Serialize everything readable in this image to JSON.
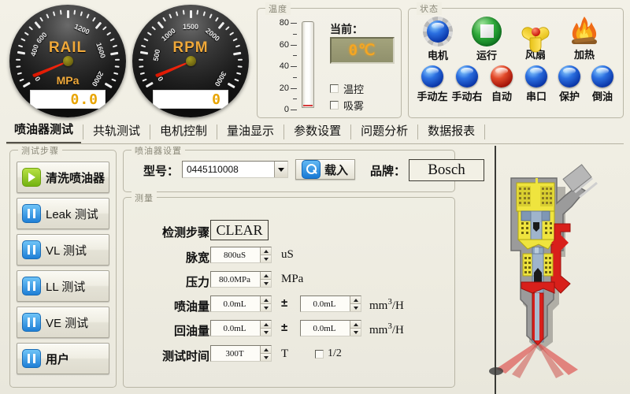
{
  "gauges": [
    {
      "name": "RAIL",
      "unit": "MPa",
      "value": "0.0",
      "ticks": [
        "0",
        "400",
        "600",
        "1200",
        "1600",
        "2000"
      ],
      "tick_values": [
        0,
        400,
        600,
        1200,
        1600,
        2000
      ],
      "min": 0,
      "max": 2000
    },
    {
      "name": "RPM",
      "unit": "",
      "value": "0",
      "ticks": [
        "0",
        "500",
        "1000",
        "1500",
        "2000",
        "3000"
      ],
      "tick_values": [
        0,
        500,
        1000,
        1500,
        2000,
        3000
      ],
      "min": 0,
      "max": 3000
    }
  ],
  "temperature": {
    "caption": "温度",
    "scale": [
      "80",
      "60",
      "40",
      "20",
      "0"
    ],
    "scale_max": 80,
    "current_label": "当前：",
    "current_value": "0℃",
    "checkboxes": [
      {
        "label": "温控",
        "checked": false
      },
      {
        "label": "吸雾",
        "checked": false
      }
    ]
  },
  "status": {
    "caption": "状态",
    "icons": [
      {
        "label": "电机",
        "icon": "gear-motor-icon"
      },
      {
        "label": "运行",
        "icon": "run-stop-icon"
      },
      {
        "label": "风扇",
        "icon": "fan-icon"
      },
      {
        "label": "加热",
        "icon": "fire-heat-icon"
      }
    ],
    "leds": [
      {
        "label": "手动左",
        "color": "#1d3fb0",
        "on": false
      },
      {
        "label": "手动右",
        "color": "#1d3fb0",
        "on": false
      },
      {
        "label": "自动",
        "color": "#c8200d",
        "on": true
      },
      {
        "label": "串口",
        "color": "#1d3fb0",
        "on": false
      },
      {
        "label": "保护",
        "color": "#1d3fb0",
        "on": false
      },
      {
        "label": "倒油",
        "color": "#1d3fb0",
        "on": false
      }
    ]
  },
  "tabs": [
    {
      "label": "喷油器测试",
      "active": true
    },
    {
      "label": "共轨测试",
      "active": false
    },
    {
      "label": "电机控制",
      "active": false
    },
    {
      "label": "量油显示",
      "active": false
    },
    {
      "label": "参数设置",
      "active": false
    },
    {
      "label": "问题分析",
      "active": false
    },
    {
      "label": "数据报表",
      "active": false
    }
  ],
  "steps": {
    "caption": "测试步骤",
    "buttons": [
      {
        "label": "清洗喷油器",
        "icon": "play-icon",
        "bold": true
      },
      {
        "label": "Leak  测试",
        "icon": "pause-icon",
        "bold": false
      },
      {
        "label": "VL  测试",
        "icon": "pause-icon",
        "bold": false
      },
      {
        "label": "LL  测试",
        "icon": "pause-icon",
        "bold": false
      },
      {
        "label": "VE  测试",
        "icon": "pause-icon",
        "bold": false
      },
      {
        "label": "用户",
        "icon": "pause-icon",
        "bold": true
      }
    ]
  },
  "injector_settings": {
    "caption": "喷油器设置",
    "model_label": "型号：",
    "model_value": "0445110008",
    "load_button": "载入",
    "brand_label": "品牌：",
    "brand_value": "Bosch"
  },
  "measure": {
    "caption": "测量",
    "step_label": "检测步骤：",
    "step_value": "CLEAR",
    "rows": [
      {
        "label": "脉宽：",
        "value": "800uS",
        "unit": "uS"
      },
      {
        "label": "压力：",
        "value": "80.0MPa",
        "unit": "MPa"
      }
    ],
    "tol_rows": [
      {
        "label": "喷油量：",
        "value": "0.0mL",
        "pm": "±",
        "tol": "0.0mL",
        "unit": "mm",
        "sup": "3",
        "unit2": "/H"
      },
      {
        "label": "回油量：",
        "value": "0.0mL",
        "pm": "±",
        "tol": "0.0mL",
        "unit": "mm",
        "sup": "3",
        "unit2": "/H"
      }
    ],
    "time_row": {
      "label": "测试时间：",
      "value": "300T",
      "unit": "T"
    },
    "half_checkbox": {
      "label": "1/2",
      "checked": false
    }
  },
  "diagram": {
    "name": "injector-cross-section"
  },
  "colors": {
    "background": "#f0eee3",
    "accent_orange": "#e8a400",
    "led_blue": "#1d3fb0",
    "led_red": "#c8200d"
  }
}
